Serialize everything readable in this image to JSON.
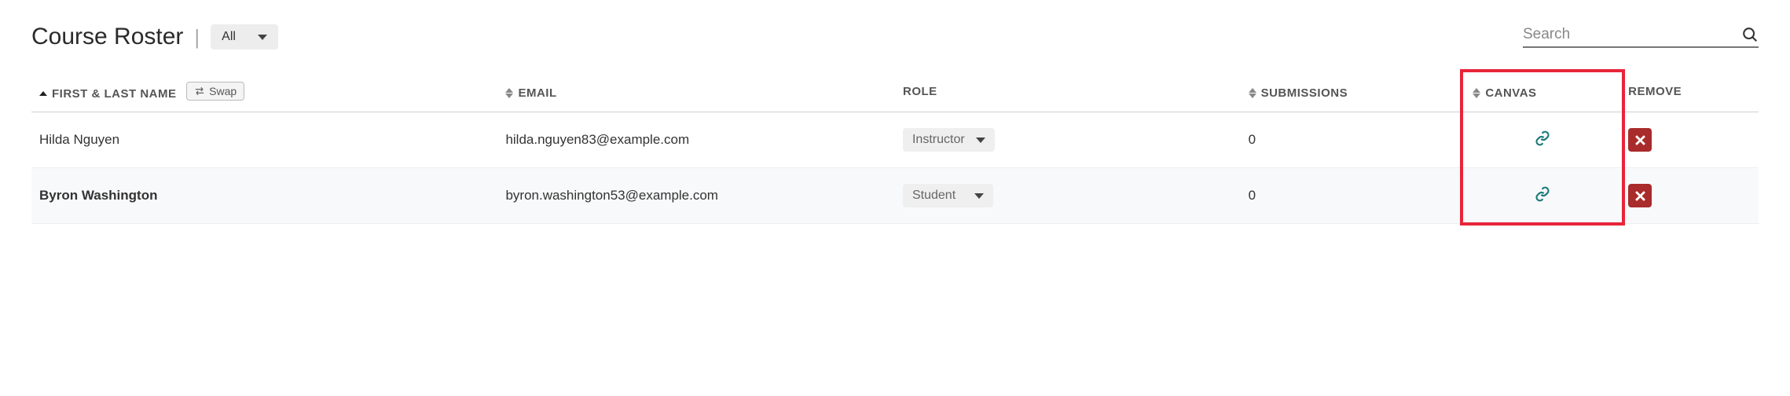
{
  "header": {
    "title": "Course Roster",
    "filter_selected": "All",
    "search_placeholder": "Search"
  },
  "columns": {
    "name": "First & Last Name",
    "swap_label": "Swap",
    "email": "Email",
    "role": "Role",
    "submissions": "Submissions",
    "canvas": "Canvas",
    "remove": "Remove"
  },
  "rows": [
    {
      "name": "Hilda Nguyen",
      "email": "hilda.nguyen83@example.com",
      "role": "Instructor",
      "submissions": "0"
    },
    {
      "name": "Byron Washington",
      "email": "byron.washington53@example.com",
      "role": "Student",
      "submissions": "0"
    }
  ],
  "highlight": {
    "column": "canvas"
  }
}
